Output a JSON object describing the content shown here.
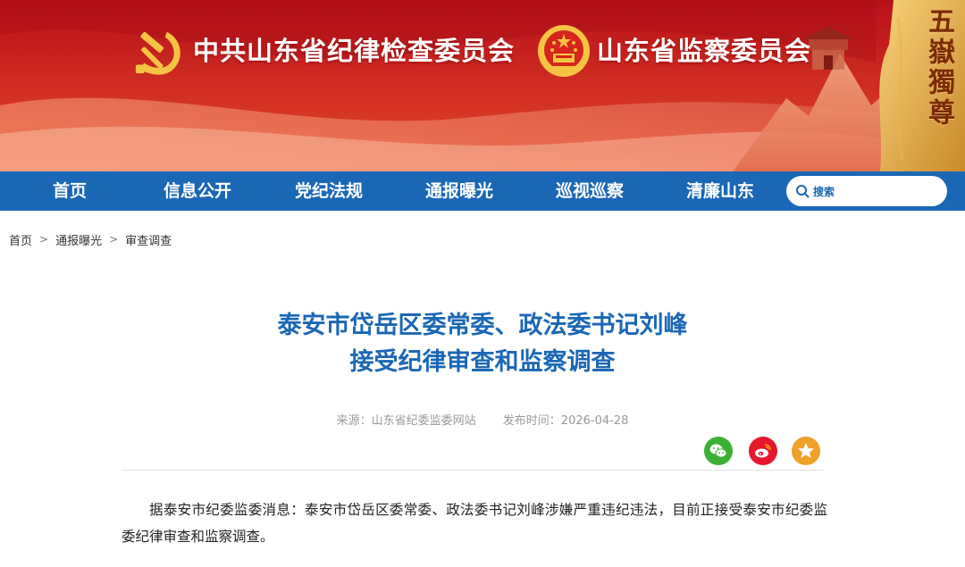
{
  "banner": {
    "org_name_party": "中共山东省纪律检查委员会",
    "org_name_state": "山东省监察委员会",
    "calligraphy": "五嶽獨尊",
    "colors": {
      "red": "#d92a20",
      "gold": "#f5c242"
    },
    "icons": [
      "party-emblem-icon",
      "national-emblem-icon"
    ]
  },
  "nav": {
    "items": [
      "首页",
      "信息公开",
      "党纪法规",
      "通报曝光",
      "巡视巡察",
      "清廉山东"
    ],
    "search_placeholder": "搜索",
    "background": "#1a67b5"
  },
  "breadcrumb": {
    "items": [
      "首页",
      "通报曝光",
      "审查调查"
    ],
    "separator": ">"
  },
  "article": {
    "title_line1": "泰安市岱岳区委常委、政法委书记刘峰",
    "title_line2": "接受纪律审查和监察调查",
    "source": "来源：山东省纪委监委网站",
    "publish_time": "发布时间：2026-04-28",
    "share_icons": [
      "wechat-icon",
      "weibo-icon",
      "favorite-star-icon"
    ],
    "body": "据泰安市纪委监委消息：泰安市岱岳区委常委、政法委书记刘峰涉嫌严重违纪违法，目前正接受泰安市纪委监委纪律审查和监察调查。"
  }
}
